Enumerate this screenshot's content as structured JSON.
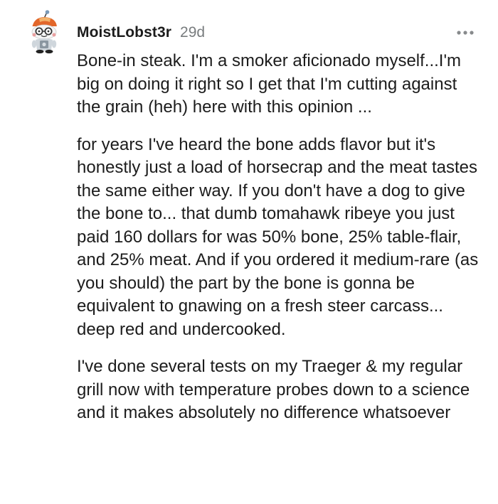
{
  "comment": {
    "author": "MoistLobst3r",
    "age": "29d",
    "avatar_icon": "snoo-avatar-icon",
    "more_icon": "more-options-icon",
    "paragraphs": [
      "Bone-in steak. I'm a smoker aficionado myself...I'm big on doing it right so I get that I'm cutting against the grain (heh) here with this opinion ...",
      "for years I've heard the bone adds flavor but it's honestly just a load of horsecrap and the meat tastes the same either way. If you don't have a dog to give the bone to... that dumb tomahawk ribeye you just paid 160 dollars for was 50% bone, 25% table-flair, and 25% meat. And if you ordered it medium-rare (as you should) the part by the bone is gonna be equivalent to gnawing on a fresh steer carcass... deep red and undercooked.",
      "I've done several tests on my Traeger & my regular grill now with temperature probes down to a science and it makes absolutely no difference whatsoever"
    ]
  }
}
